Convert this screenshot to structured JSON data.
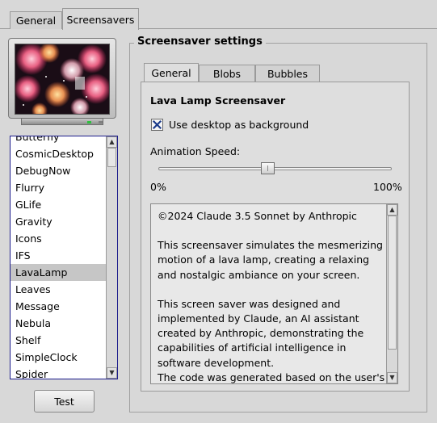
{
  "tabs": [
    {
      "label": "General"
    },
    {
      "label": "Screensavers"
    }
  ],
  "screensaver_list": {
    "items": [
      "Butterfly",
      "CosmicDesktop",
      "DebugNow",
      "Flurry",
      "GLife",
      "Gravity",
      "Icons",
      "IFS",
      "LavaLamp",
      "Leaves",
      "Message",
      "Nebula",
      "Shelf",
      "SimpleClock",
      "Spider"
    ],
    "selected": "LavaLamp"
  },
  "test_button": {
    "label": "Test"
  },
  "settings": {
    "group_title": "Screensaver settings",
    "tabs": [
      {
        "label": "General"
      },
      {
        "label": "Blobs"
      },
      {
        "label": "Bubbles"
      }
    ],
    "heading": "Lava Lamp Screensaver",
    "use_desktop_label": "Use desktop as background",
    "use_desktop_checked": true,
    "speed_label": "Animation Speed:",
    "speed_min": "0%",
    "speed_max": "100%",
    "speed_value": 0.5,
    "about": {
      "copyright": "©2024 Claude 3.5 Sonnet by Anthropic",
      "p1": "This screensaver simulates the mesmerizing motion of a lava lamp, creating a relaxing and nostalgic ambiance on your screen.",
      "p2": "This screen saver was designed and implemented by Claude, an AI assistant created by Anthropic, demonstrating the capabilities of artificial intelligence in software development.",
      "p3": "The code was generated based on the user's requirements and best practices for Haiku"
    }
  },
  "colors": {
    "accent_border": "#1c1c8c",
    "checkbox_mark": "#1c3c8c",
    "led": "#2dc13e"
  }
}
